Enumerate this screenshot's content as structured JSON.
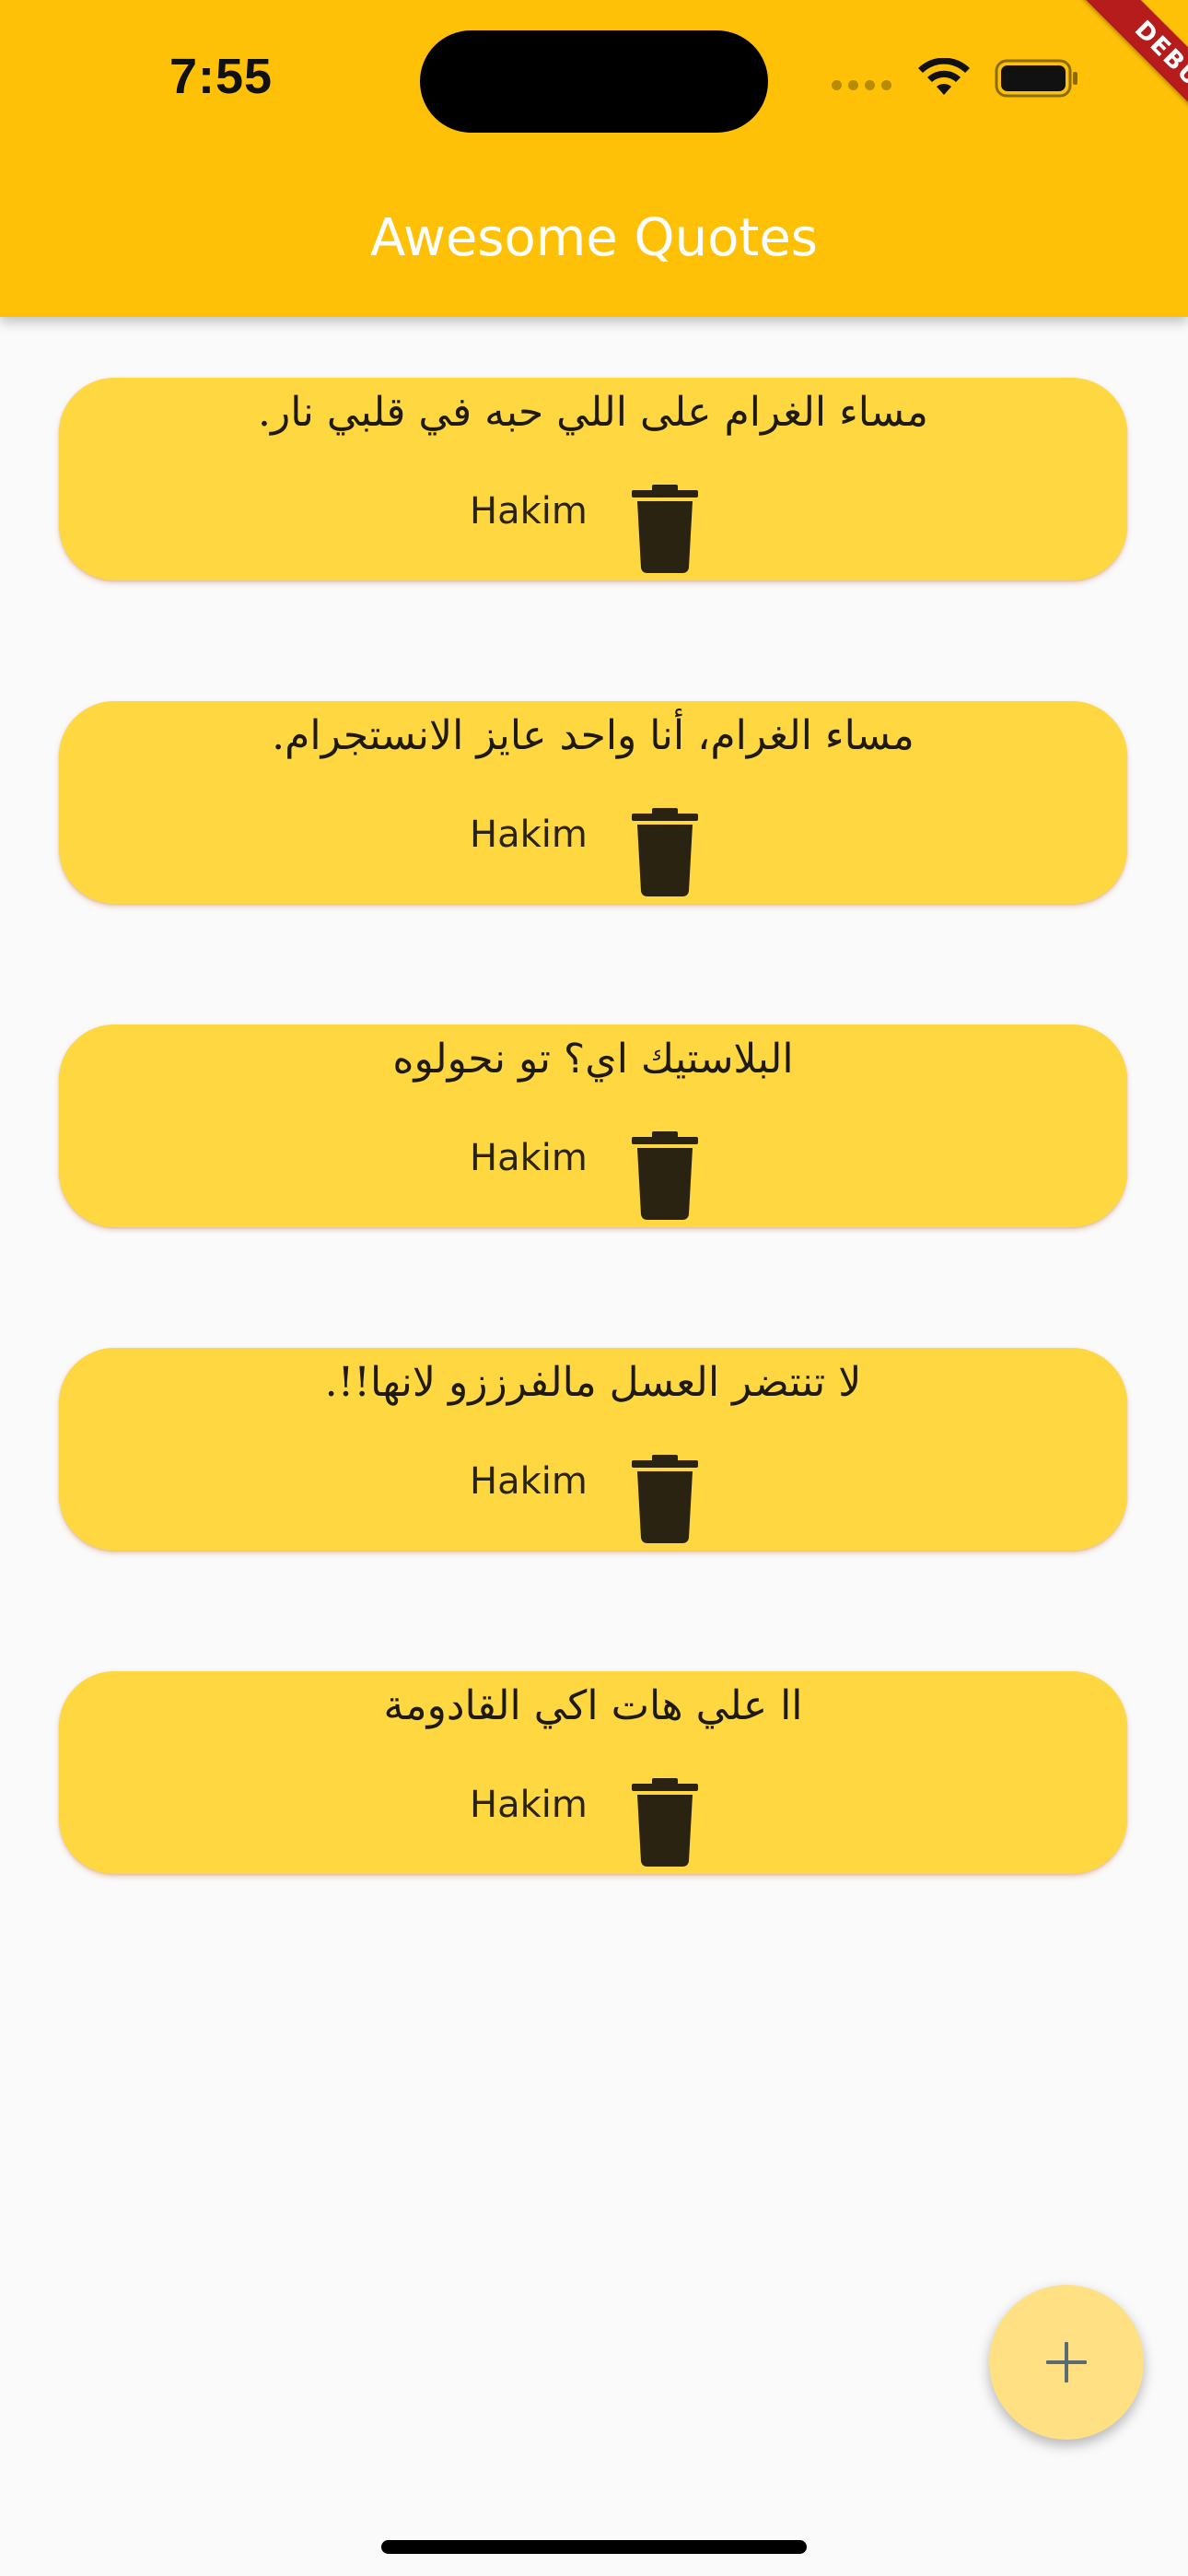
{
  "status_bar": {
    "time": "7:55",
    "icons": [
      "cellular-signal-icon",
      "wifi-icon",
      "battery-icon"
    ]
  },
  "debug_banner": {
    "label": "DEBUG"
  },
  "app_bar": {
    "title": "Awesome Quotes"
  },
  "quotes": [
    {
      "text": "مساء الغرام على اللي حبه في قلبي نار.",
      "author": "Hakim"
    },
    {
      "text": "مساء الغرام، أنا واحد عايز الانستجرام.",
      "author": "Hakim"
    },
    {
      "text": "البلاستيك اي؟ تو نحولوه",
      "author": "Hakim"
    },
    {
      "text": "لا تنتضر العسل مالفرززو لانها!!.",
      "author": "Hakim"
    },
    {
      "text": "اا  علي هات اكي القادومة",
      "author": "Hakim"
    }
  ],
  "fab": {
    "icon": "plus-icon"
  },
  "colors": {
    "app_bar": "#FFC107",
    "card": "#FFD740",
    "fab": "#FFE082",
    "background": "#FAFAFA",
    "debug_banner": "#B71C1C"
  }
}
